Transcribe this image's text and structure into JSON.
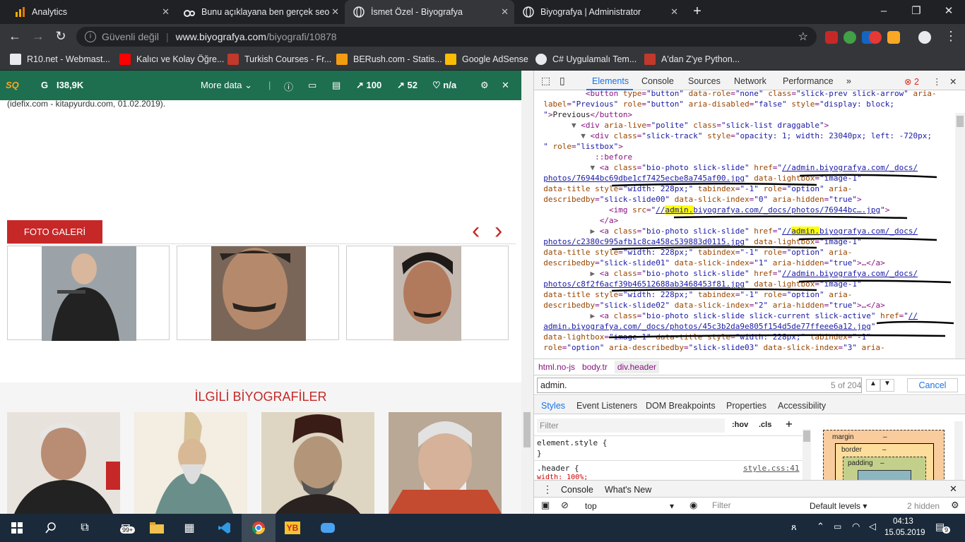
{
  "tabs": [
    {
      "title": "Analytics",
      "icon": "analytics-icon",
      "color": "#f9ab00"
    },
    {
      "title": "Bunu açıklayana ben gerçek seo",
      "icon": "webmaster-icon",
      "color": "#e8eaed"
    },
    {
      "title": "İsmet Özel - Biyografya",
      "icon": "globe-icon",
      "color": "#e8eaed",
      "active": true
    },
    {
      "title": "Biyografya | Administrator",
      "icon": "globe-icon",
      "color": "#e8eaed"
    }
  ],
  "window": {
    "new_tab": "+",
    "minimize": "–",
    "maximize": "❐",
    "close": "✕"
  },
  "address": {
    "security": "Güvenli değil",
    "host": "www.biyografya.com",
    "path": "/biyografi/10878"
  },
  "bookmarks": [
    {
      "label": "R10.net - Webmast...",
      "color": "#e8eaed"
    },
    {
      "label": "Kalıcı ve Kolay Öğre...",
      "color": "#ff0000"
    },
    {
      "label": "Turkish Courses - Fr...",
      "color": "#c0392b"
    },
    {
      "label": "BERush.com - Statis...",
      "color": "#f39c12"
    },
    {
      "label": "Google AdSense",
      "color": "#fbbc04"
    },
    {
      "label": "C# Uygulamalı Tem...",
      "color": "#e8eaed"
    },
    {
      "label": "A'dan Z'ye Python...",
      "color": "#c0392b"
    }
  ],
  "seoquake": {
    "logo": "SQ",
    "google": "G",
    "google_count": "I38,9K",
    "more": "More data",
    "links": "100",
    "links2": "52",
    "na": "n/a"
  },
  "page": {
    "citation": "(idefix.com - kitapyurdu.com, 01.02.2019).",
    "gallery_title": "FOTO GALERİ",
    "prev": "‹",
    "next": "›",
    "related_title": "İLGİLİ BİYOGRAFİLER"
  },
  "devtools": {
    "tabs": [
      "Elements",
      "Console",
      "Sources",
      "Network",
      "Performance"
    ],
    "more": "»",
    "errors": "2",
    "crumbs": [
      "html.no-js",
      "body.tr",
      "div.header"
    ],
    "find": {
      "query": "admin.",
      "count": "5 of 204",
      "cancel": "Cancel"
    },
    "style_tabs": [
      "Styles",
      "Event Listeners",
      "DOM Breakpoints",
      "Properties",
      "Accessibility"
    ],
    "filter": "Filter",
    "hov": ":hov",
    "cls": ".cls",
    "element_style": "element.style {",
    "close_brace": "}",
    "header_rule": ".header {",
    "header_prop": "  width: 100%;",
    "style_src": "style.css:41",
    "box_margin": "margin",
    "box_border": "border",
    "box_padding": "padding",
    "dash": "–",
    "console_tabs": [
      "Console",
      "What's New"
    ],
    "context": "top",
    "levels": "Default levels",
    "hidden": "2 hidden"
  },
  "taskbar": {
    "time": "04:13",
    "date": "15.05.2019",
    "badge": "99+",
    "notif": "9"
  }
}
